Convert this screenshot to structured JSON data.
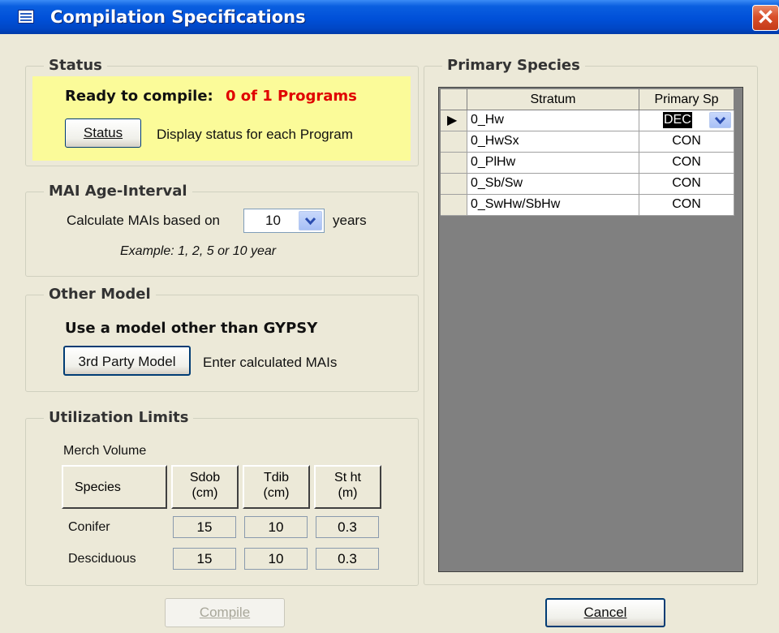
{
  "window": {
    "title": "Compilation Specifications",
    "close_glyph": "✕"
  },
  "status": {
    "legend": "Status",
    "ready_label": "Ready to compile:",
    "ready_value": "0 of 1 Programs",
    "ready_color": "#e00000",
    "panel_color": "#fbfb99",
    "button_label": "Status",
    "description": "Display status for each Program"
  },
  "mai": {
    "legend": "MAI Age-Interval",
    "label": "Calculate MAIs based on",
    "interval_value": "10",
    "unit": "years",
    "example": "Example: 1, 2, 5 or 10 year"
  },
  "other_model": {
    "legend": "Other Model",
    "heading": "Use a model other than GYPSY",
    "button_label": "3rd Party Model",
    "description": "Enter calculated MAIs"
  },
  "utilization": {
    "legend": "Utilization Limits",
    "subtitle": "Merch Volume",
    "headers": {
      "species": "Species",
      "sdob_1": "Sdob",
      "sdob_2": "(cm)",
      "tdib_1": "Tdib",
      "tdib_2": "(cm)",
      "stht_1": "St ht",
      "stht_2": "(m)"
    },
    "rows": [
      {
        "species": "Conifer",
        "sdob": "15",
        "tdib": "10",
        "stht": "0.3"
      },
      {
        "species": "Desciduous",
        "sdob": "15",
        "tdib": "10",
        "stht": "0.3"
      }
    ]
  },
  "primary_species": {
    "legend": "Primary Species",
    "columns": [
      "Stratum",
      "Primary Sp"
    ],
    "rows": [
      {
        "stratum": "0_Hw",
        "primary_sp": "DEC"
      },
      {
        "stratum": "0_HwSx",
        "primary_sp": "CON"
      },
      {
        "stratum": "0_PlHw",
        "primary_sp": "CON"
      },
      {
        "stratum": "0_Sb/Sw",
        "primary_sp": "CON"
      },
      {
        "stratum": "0_SwHw/SbHw",
        "primary_sp": "CON"
      }
    ],
    "current_row_marker": "▶"
  },
  "footer": {
    "compile_label": "Compile",
    "cancel_label": "Cancel"
  },
  "icons": {
    "window": "form-icon",
    "dropdown": "chevron-down-icon",
    "row_pointer": "row-pointer-icon"
  }
}
